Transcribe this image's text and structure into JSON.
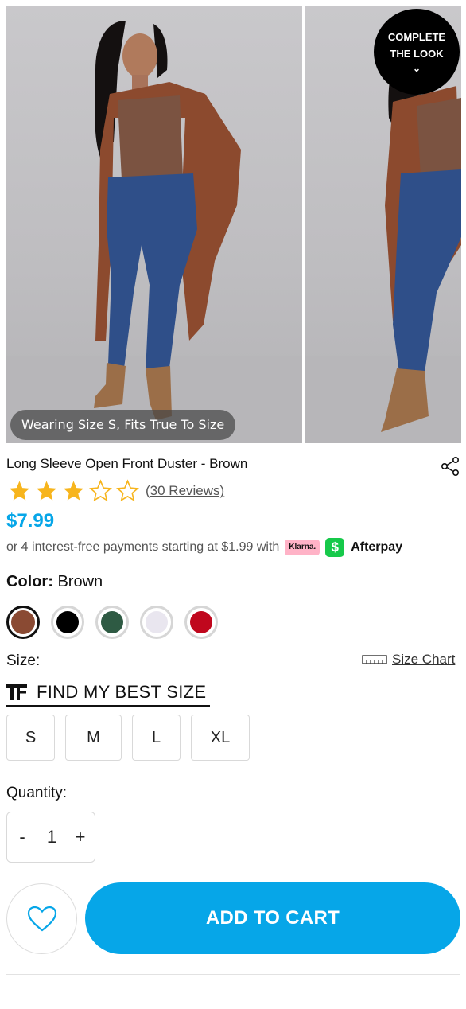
{
  "gallery": {
    "size_note": "Wearing Size S, Fits True To Size",
    "complete_look_line1": "COMPLETE",
    "complete_look_line2": "THE LOOK"
  },
  "product": {
    "title": "Long Sleeve Open Front Duster - Brown",
    "rating_stars": 3,
    "rating_max": 5,
    "reviews": "(30 Reviews)",
    "price": "$7.99",
    "installments_text": "or 4 interest-free payments starting at $1.99 with",
    "klarna_label": "Klarna.",
    "afterpay_label": "Afterpay"
  },
  "color": {
    "label": "Color:",
    "selected": "Brown",
    "swatches": [
      "#8a4a33",
      "#000000",
      "#2e5a43",
      "#e9e6ef",
      "#c0071d"
    ]
  },
  "size": {
    "label": "Size:",
    "chart_label": "Size Chart",
    "find_best_label": "FIND MY BEST SIZE",
    "options": [
      "S",
      "M",
      "L",
      "XL"
    ]
  },
  "quantity": {
    "label": "Quantity:",
    "minus": "-",
    "value": "1",
    "plus": "+"
  },
  "actions": {
    "add_to_cart": "ADD TO CART"
  },
  "colors": {
    "accent": "#06a6e8",
    "star": "#f7b51d"
  }
}
